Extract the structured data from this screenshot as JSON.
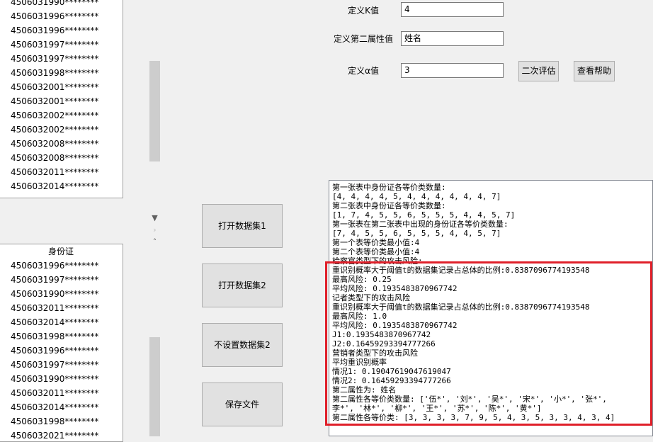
{
  "list_top": {
    "items": [
      "4506031990********",
      "4506031996********",
      "4506031996********",
      "4506031997********",
      "4506031997********",
      "4506031998********",
      "4506032001********",
      "4506032001********",
      "4506032002********",
      "4506032002********",
      "4506032008********",
      "4506032008********",
      "4506032011********",
      "4506032014********"
    ]
  },
  "list_bottom": {
    "header": "身份证",
    "items": [
      "4506031996********",
      "4506031997********",
      "4506031990********",
      "4506032011********",
      "4506032014********",
      "4506031998********",
      "4506031996********",
      "4506031997********",
      "4506031990********",
      "4506032011********",
      "4506032014********",
      "4506031998********",
      "4506032021********"
    ]
  },
  "icons": {
    "scroll_down": "▼",
    "scroll_right": "›",
    "scroll_up": "˄"
  },
  "buttons": {
    "open1": "打开数据集1",
    "open2": "打开数据集2",
    "no_set2": "不设置数据集2",
    "save": "保存文件",
    "second_eval": "二次评估",
    "help": "查看帮助"
  },
  "form": {
    "k_label": "定义K值",
    "k_value": "4",
    "attr_label": "定义第二属性值",
    "attr_value": "姓名",
    "alpha_label": "定义α值",
    "alpha_value": "3"
  },
  "output_lines": [
    "第一张表中身份证各等价类数量:",
    "[4, 4, 4, 4, 5, 4, 4, 4, 4, 4, 4, 7]",
    "第二张表中身份证各等价类数量:",
    "[1, 7, 4, 5, 5, 6, 5, 5, 5, 4, 4, 5, 7]",
    "第一张表在第二张表中出现的身份证各等价类数量:",
    "[7, 4, 5, 5, 6, 5, 5, 5, 4, 4, 5, 7]",
    "第一个表等价类最小值:4",
    "第二个表等价类最小值:4",
    "检察官类型下的攻击风险:",
    "重识别概率大于阈值t的数据集记录占总体的比例:0.8387096774193548",
    "最高风险: 0.25",
    "平均风险: 0.1935483870967742",
    "记者类型下的攻击风险",
    "重识别概率大于阈值t的数据集记录占总体的比例:0.8387096774193548",
    "最高风险: 1.0",
    "平均风险: 0.1935483870967742",
    "J1:0.1935483870967742",
    "J2:0.16459293394777266",
    "营销者类型下的攻击风险",
    "平均重识别概率",
    "情况1: 0.19047619047619047",
    "情况2: 0.16459293394777266",
    "第二属性为: 姓名",
    "第二属性各等价类数量: ['伍*', '刘*', '吴*', '宋*', '小*', '张*',",
    "李*', '林*', '柳*', '王*', '苏*', '陈*', '黄*']",
    "第二属性各等价类: [3, 3, 3, 3, 7, 9, 5, 4, 3, 5, 3, 3, 4, 3, 4]"
  ],
  "colors": {
    "highlight": "#e0202a"
  }
}
